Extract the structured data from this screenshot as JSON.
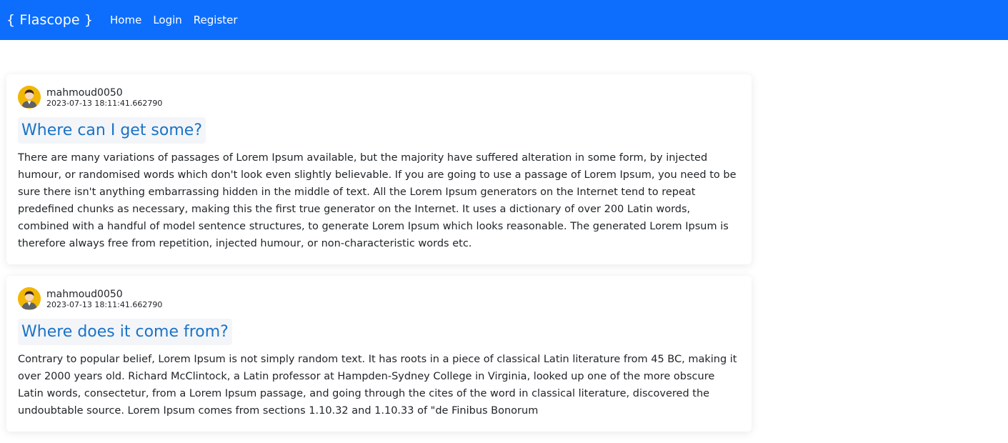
{
  "navbar": {
    "brand": "{ Flascope }",
    "links": [
      "Home",
      "Login",
      "Register"
    ],
    "color": "#0d6efd"
  },
  "posts": [
    {
      "author": "mahmoud0050",
      "date": "2023-07-13 18:11:41.662790",
      "title": "Where can I get some?",
      "content": "There are many variations of passages of Lorem Ipsum available, but the majority have suffered alteration in some form, by injected humour, or randomised words which don't look even slightly believable. If you are going to use a passage of Lorem Ipsum, you need to be sure there isn't anything embarrassing hidden in the middle of text. All the Lorem Ipsum generators on the Internet tend to repeat predefined chunks as necessary, making this the first true generator on the Internet. It uses a dictionary of over 200 Latin words, combined with a handful of model sentence structures, to generate Lorem Ipsum which looks reasonable. The generated Lorem Ipsum is therefore always free from repetition, injected humour, or non-characteristic words etc."
    },
    {
      "author": "mahmoud0050",
      "date": "2023-07-13 18:11:41.662790",
      "title": "Where does it come from?",
      "content": "Contrary to popular belief, Lorem Ipsum is not simply random text. It has roots in a piece of classical Latin literature from 45 BC, making it over 2000 years old. Richard McClintock, a Latin professor at Hampden-Sydney College in Virginia, looked up one of the more obscure Latin words, consectetur, from a Lorem Ipsum passage, and going through the cites of the word in classical literature, discovered the undoubtable source. Lorem Ipsum comes from sections 1.10.32 and 1.10.33 of \"de Finibus Bonorum"
    }
  ],
  "colors": {
    "title": "#1a73c8",
    "avatar_bg": "#f2b705"
  }
}
